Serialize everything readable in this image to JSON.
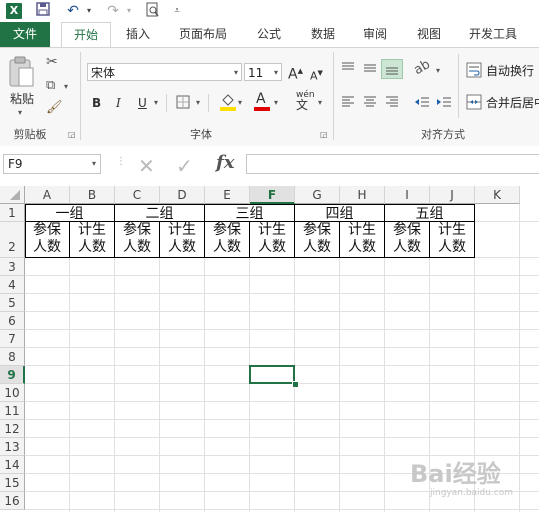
{
  "titlebar": {
    "app_icon": "X"
  },
  "tabs": [
    {
      "label": "文件"
    },
    {
      "label": "开始"
    },
    {
      "label": "插入"
    },
    {
      "label": "页面布局"
    },
    {
      "label": "公式"
    },
    {
      "label": "数据"
    },
    {
      "label": "审阅"
    },
    {
      "label": "视图"
    },
    {
      "label": "开发工具"
    }
  ],
  "ribbon": {
    "clipboard": {
      "paste_label": "粘贴",
      "group_label": "剪贴板"
    },
    "font": {
      "font_name": "宋体",
      "font_size": "11",
      "group_label": "字体",
      "bold": "B",
      "italic": "I",
      "underline": "U",
      "grow": "A",
      "shrink": "A",
      "color_a": "A",
      "wen": "wén"
    },
    "alignment": {
      "wrap_label": "自动换行",
      "merge_label": "合并后居中",
      "group_label": "对齐方式"
    }
  },
  "formula_bar": {
    "name_box": "F9",
    "fx": "fx",
    "value": ""
  },
  "grid": {
    "columns": [
      "A",
      "B",
      "C",
      "D",
      "E",
      "F",
      "G",
      "H",
      "I",
      "J",
      "K"
    ],
    "rows": [
      "1",
      "2",
      "3",
      "4",
      "5",
      "6",
      "7",
      "8",
      "9",
      "10",
      "11",
      "12",
      "13",
      "14",
      "15",
      "16"
    ],
    "selected_column": "F",
    "selected_row": "9",
    "group_headers": [
      "一组",
      "二组",
      "三组",
      "四组",
      "五组"
    ],
    "sub_headers": [
      {
        "line1": "参保",
        "line2": "人数"
      },
      {
        "line1": "计生",
        "line2": "人数"
      }
    ]
  },
  "watermark": {
    "text": "Bai经验",
    "sub": "jingyan.baidu.com"
  },
  "colors": {
    "excel_green": "#217346",
    "font_color_bar": "#e00000",
    "fill_color_bar": "#ffe000"
  }
}
